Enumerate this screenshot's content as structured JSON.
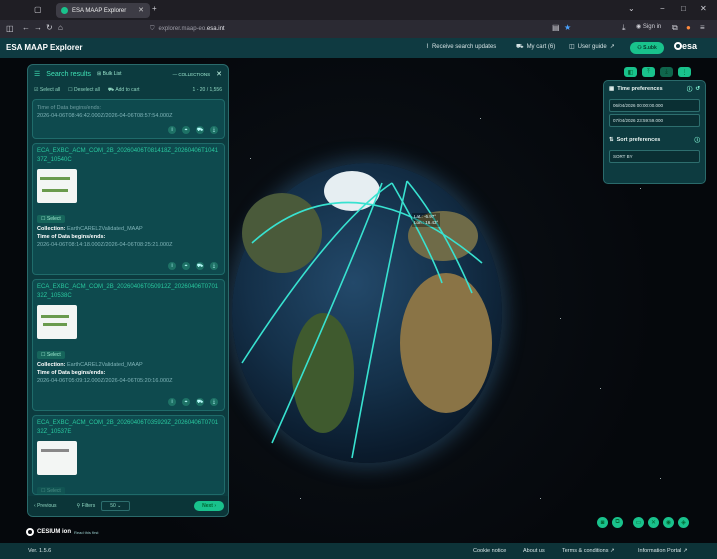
{
  "browser": {
    "tab_title": "ESA MAAP Explorer",
    "url_prefix": "explorer.maap-eo.",
    "url_domain": "esa.int",
    "window_controls": [
      "−",
      "□",
      "✕"
    ]
  },
  "app": {
    "title": "ESA MAAP Explorer",
    "nav": {
      "receive_updates": "Receive search updates",
      "my_cart": "My cart (6)",
      "user_guide": "User guide"
    },
    "user": "S.ubk",
    "logo": "esa"
  },
  "search_panel": {
    "title": "Search results",
    "bulk_list": "Bulk List",
    "collections": "— COLLECTIONS",
    "select_all": "Select all",
    "deselect_all": "Deselect all",
    "add_to_cart": "Add to cart",
    "range": "1 - 20 / 1,556",
    "partial": {
      "label": "Time of Data begins/ends:",
      "value": "2026-04-06T08:46:42.000Z/2026-04-06T08:57:54.000Z"
    },
    "items": [
      {
        "title": "ECA_EXBC_ACM_COM_2B_20260406T081418Z_20260406T104137Z_10540C",
        "select": "Select",
        "collection_label": "Collection:",
        "collection": "EarthCAREL2Validated_MAAP",
        "time_label": "Time of Data begins/ends:",
        "time": "2026-04-06T08:14:18.000Z/2026-04-06T08:25:21.000Z"
      },
      {
        "title": "ECA_EXBC_ACM_COM_2B_20260406T050912Z_20260406T070132Z_10538C",
        "select": "Select",
        "collection_label": "Collection:",
        "collection": "EarthCAREL2Validated_MAAP",
        "time_label": "Time of Data begins/ends:",
        "time": "2026-04-06T05:09:12.000Z/2026-04-06T05:20:16.000Z"
      },
      {
        "title": "ECA_EXBC_ACM_COM_2B_20260406T035929Z_20260406T070132Z_10537E",
        "select": "Select"
      }
    ],
    "footer": {
      "previous": "Previous",
      "filters": "Filters",
      "page_size": "50",
      "next": "Next"
    }
  },
  "prefs": {
    "time_title": "Time preferences",
    "start": "06/04/2026 00:00:00.000",
    "end": "07/04/2026 23:59:59.000",
    "sort_title": "Sort preferences",
    "sort_by": "SORT BY"
  },
  "globe": {
    "lat": "Lat.: -6.97°",
    "lon": "Lon.: 16.43°"
  },
  "cesium": {
    "brand": "CESIUM ion",
    "link": "Read this first"
  },
  "footer": {
    "version": "Ver. 1.5.6",
    "links": [
      "Cookie notice",
      "About us",
      "Terms & conditions",
      "Information Portal"
    ]
  },
  "colors": {
    "accent": "#19c28c",
    "panel": "#0c3b3f",
    "appbar": "#0f3a41",
    "track": "#38e2d0"
  }
}
